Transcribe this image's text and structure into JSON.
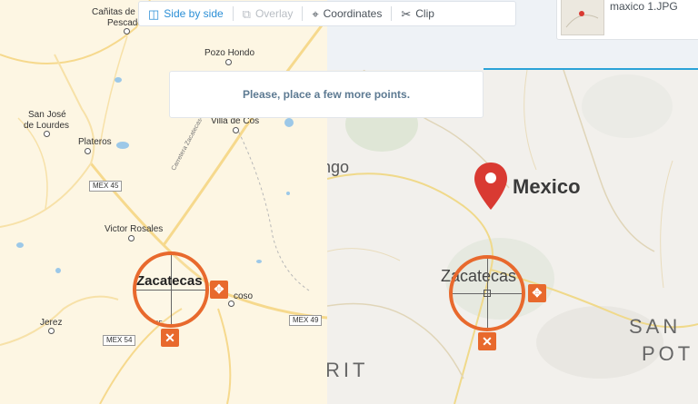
{
  "toolbar": {
    "side_by_side": "Side by side",
    "overlay": "Overlay",
    "coordinates": "Coordinates",
    "clip": "Clip"
  },
  "message": "Please, place a few more points.",
  "thumbnail": {
    "filename": "maxico 1.JPG"
  },
  "left_map": {
    "places": {
      "canitas": "Cañitas de",
      "canitas2": "Pescador",
      "pozo_hondo": "Pozo Hondo",
      "san_jose": "San José",
      "san_jose2": "de Lourdes",
      "plateros": "Plateros",
      "villa_de_cos": "Villa de Cos",
      "victor_rosales": "Victor Rosales",
      "zacatecas": "Zacatecas",
      "guadalupe": "coso",
      "jerez": "Jerez",
      "road_name": "Carretera Zacatecas-Saltillo"
    },
    "shields": {
      "mex45a": "MEX 45",
      "mex45b": "45",
      "mex49": "MEX 49",
      "mex54": "MEX 54"
    }
  },
  "right_map": {
    "pin_label": "Mexico",
    "zacatecas": "Zacatecas",
    "durango_partial": "ngo",
    "san_luis_1": "SAN",
    "san_luis_2": "POT",
    "nayarit_partial": "RIT"
  },
  "colors": {
    "accent": "#e8692d",
    "toolbar_active": "#2b8fd6",
    "pin": "#d93a32"
  }
}
